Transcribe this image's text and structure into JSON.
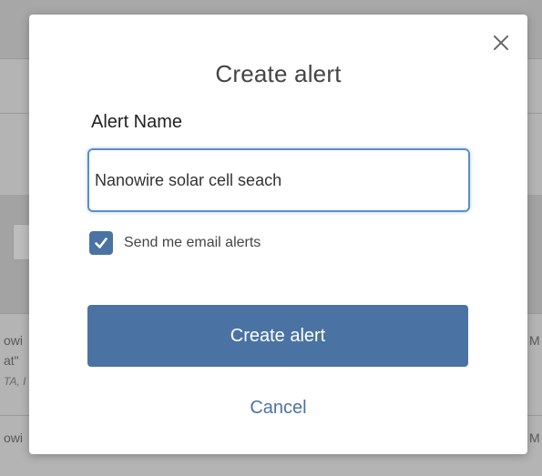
{
  "modal": {
    "title": "Create alert",
    "alert_name_label": "Alert Name",
    "alert_name_value": "Nanowire solar cell seach",
    "email_alerts_label": "Send me email alerts",
    "email_alerts_checked": true,
    "create_button_label": "Create alert",
    "cancel_label": "Cancel",
    "close_icon": "close-icon"
  },
  "background": {
    "row1_line1": "owi",
    "row1_line2": "at\"",
    "row1_line3": "TA, I",
    "row2_line1": "owi",
    "right_fragment_1": "M",
    "right_fragment_2": "M"
  },
  "colors": {
    "accent": "#4a73a3",
    "focus_border": "#5b8fc6"
  }
}
